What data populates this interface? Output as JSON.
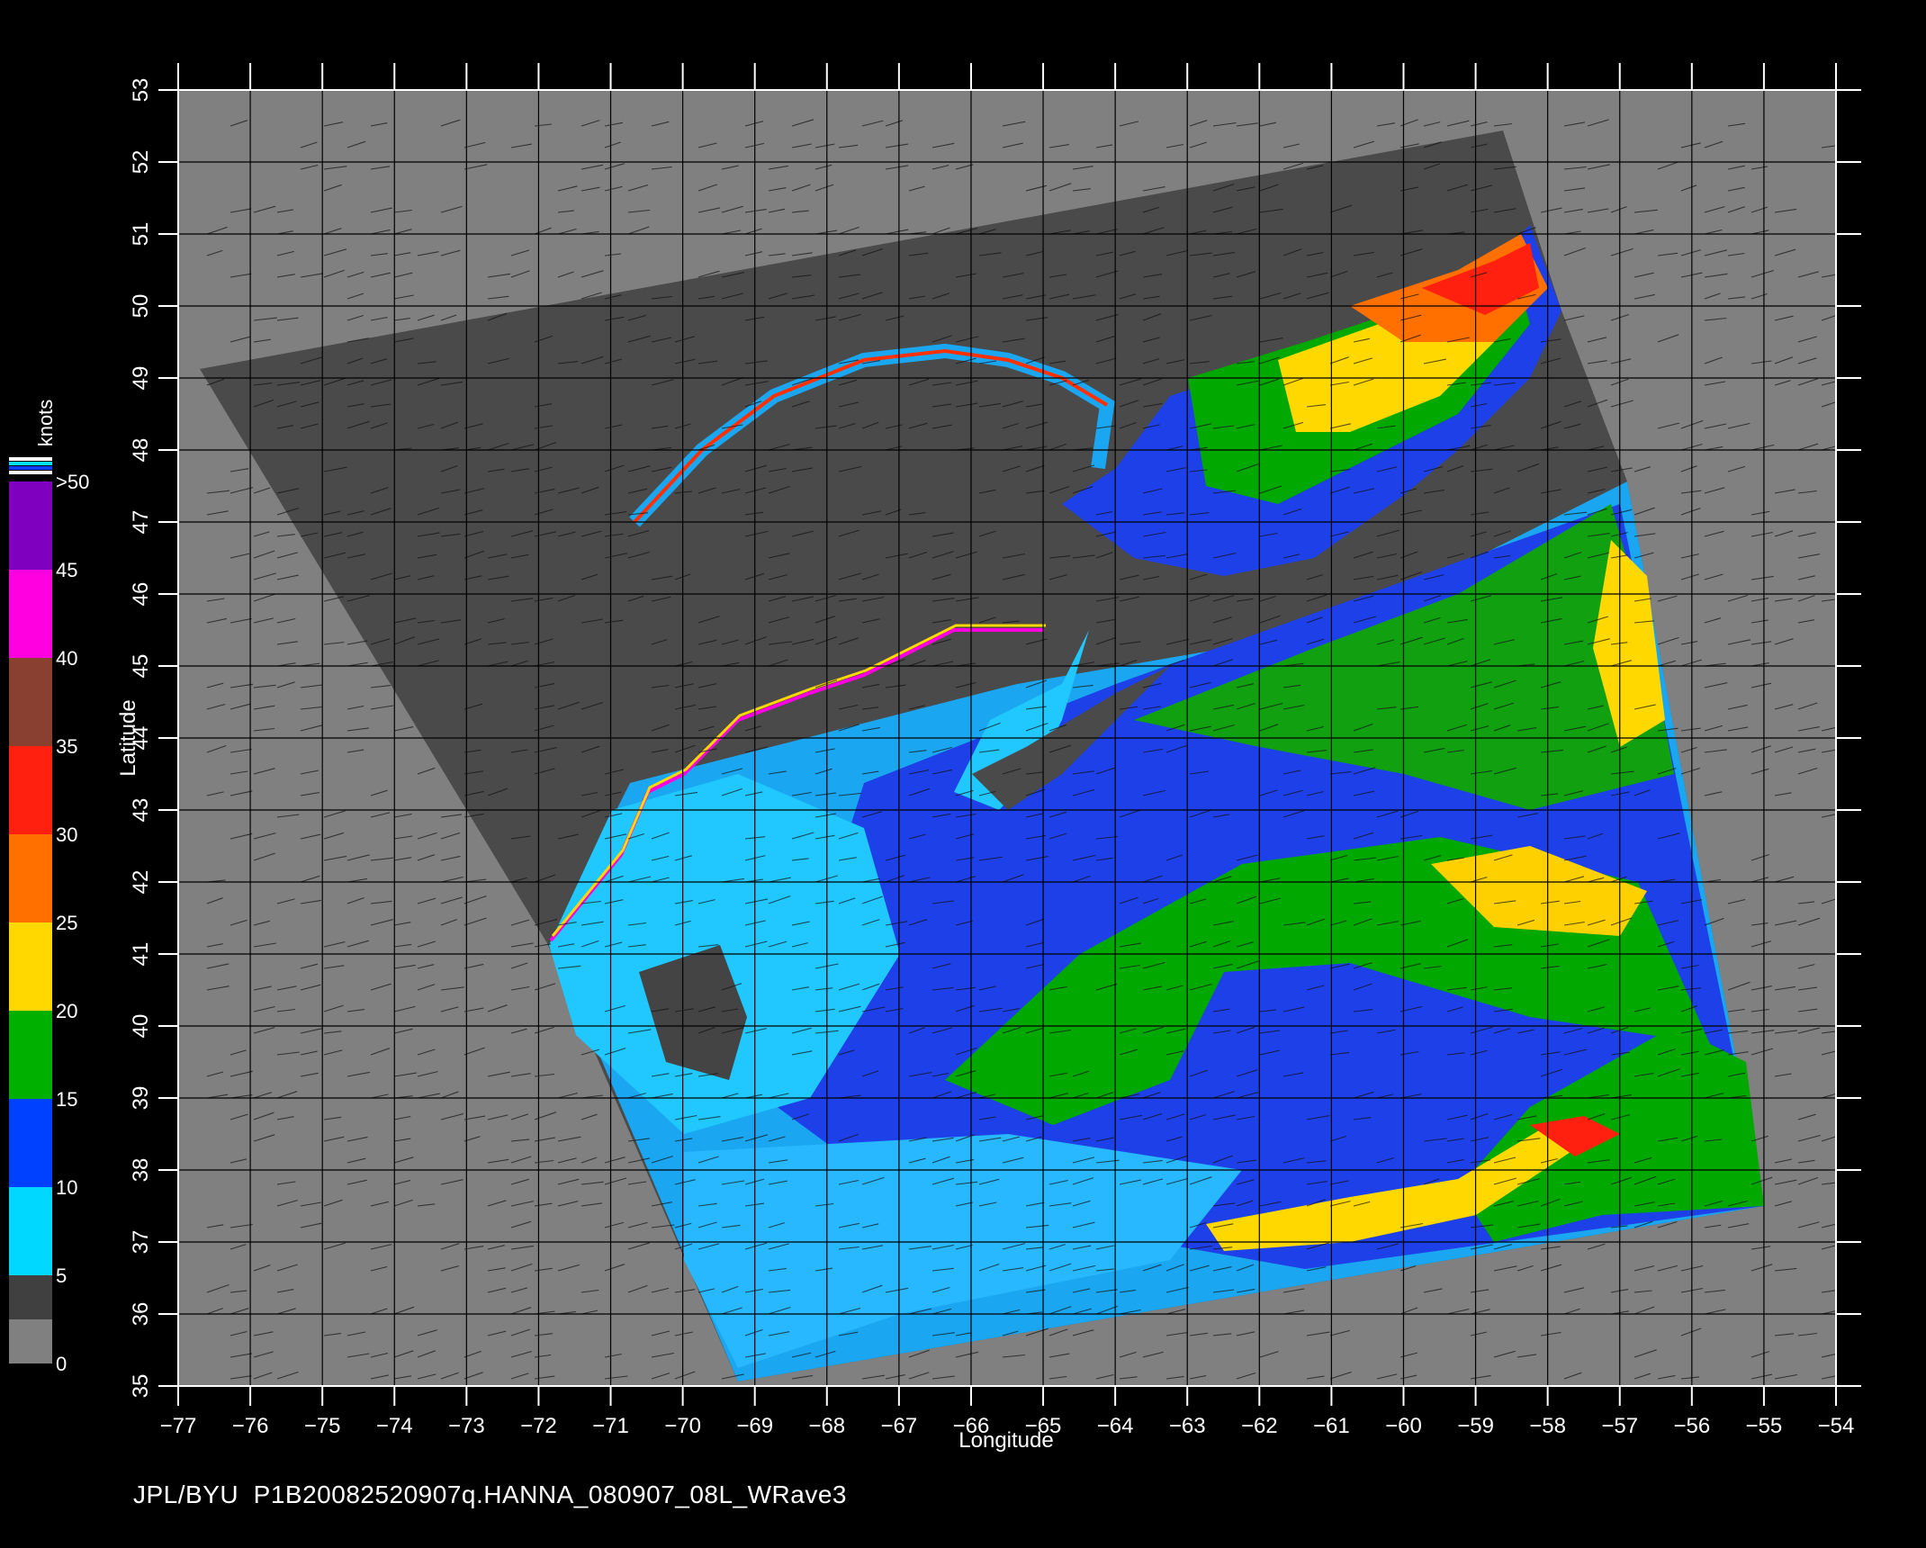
{
  "map": {
    "x_axis": {
      "label": "Longitude",
      "range": [
        -77,
        -54
      ],
      "ticks": [
        "-77",
        "-76",
        "-75",
        "-74",
        "-73",
        "-72",
        "-71",
        "-70",
        "-69",
        "-68",
        "-67",
        "-66",
        "-65",
        "-64",
        "-63",
        "-62",
        "-61",
        "-60",
        "-59",
        "-58",
        "-57",
        "-56",
        "-55",
        "-54"
      ]
    },
    "y_axis": {
      "label": "Latitude",
      "range": [
        35,
        53
      ],
      "ticks": [
        "35",
        "36",
        "37",
        "38",
        "39",
        "40",
        "41",
        "42",
        "43",
        "44",
        "45",
        "46",
        "47",
        "48",
        "49",
        "50",
        "51",
        "52",
        "53"
      ]
    },
    "grid": true,
    "background_color": "#808080",
    "swath_dark_color": "#4a4a4a"
  },
  "colorbar": {
    "units": "knots",
    "placement": "left",
    "labels": [
      "0",
      "5",
      "10",
      "15",
      "20",
      "25",
      "30",
      "35",
      "40",
      "45",
      ">50"
    ],
    "bands": [
      {
        "from": 0,
        "to": 5,
        "color": "#5a5a5a"
      },
      {
        "from": 5,
        "to": 10,
        "color": "#00d8ff"
      },
      {
        "from": 10,
        "to": 15,
        "color": "#0040ff"
      },
      {
        "from": 15,
        "to": 20,
        "color": "#00b000"
      },
      {
        "from": 20,
        "to": 25,
        "color": "#ffd800"
      },
      {
        "from": 25,
        "to": 30,
        "color": "#ff7000"
      },
      {
        "from": 30,
        "to": 35,
        "color": "#ff2010"
      },
      {
        "from": 35,
        "to": 40,
        "color": "#8a4030"
      },
      {
        "from": 40,
        "to": 45,
        "color": "#ff00e0"
      },
      {
        "from": 45,
        "to": 50,
        "color": "#8000c0"
      }
    ]
  },
  "footer": {
    "source": "JPL/BYU",
    "filename": "P1B20082520907q.HANNA_080907_08L_WRave3"
  }
}
